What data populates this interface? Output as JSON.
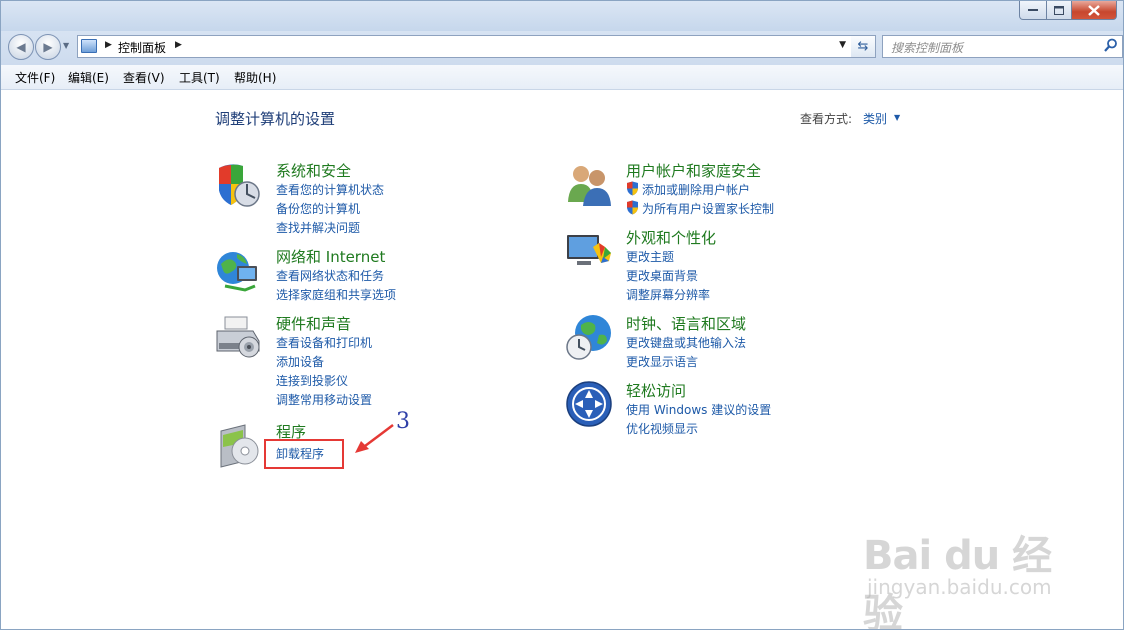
{
  "window": {
    "address": {
      "path": "控制面板"
    },
    "search": {
      "placeholder": "搜索控制面板"
    }
  },
  "menubar": [
    "文件(F)",
    "编辑(E)",
    "查看(V)",
    "工具(T)",
    "帮助(H)"
  ],
  "page": {
    "heading": "调整计算机的设置",
    "view_by_label": "查看方式:",
    "view_by_value": "类别"
  },
  "categories": [
    {
      "title": "系统和安全",
      "icon": "shield-icon",
      "links": [
        "查看您的计算机状态",
        "备份您的计算机",
        "查找并解决问题"
      ]
    },
    {
      "title": "网络和 Internet",
      "icon": "network-globe-icon",
      "links": [
        "查看网络状态和任务",
        "选择家庭组和共享选项"
      ]
    },
    {
      "title": "硬件和声音",
      "icon": "printer-icon",
      "links": [
        "查看设备和打印机",
        "添加设备",
        "连接到投影仪",
        "调整常用移动设置"
      ]
    },
    {
      "title": "程序",
      "icon": "programs-disc-icon",
      "links": [
        "卸载程序"
      ]
    },
    {
      "title": "用户帐户和家庭安全",
      "icon": "users-icon",
      "links": [
        "添加或删除用户帐户",
        "为所有用户设置家长控制"
      ]
    },
    {
      "title": "外观和个性化",
      "icon": "monitor-palette-icon",
      "links": [
        "更改主题",
        "更改桌面背景",
        "调整屏幕分辨率"
      ]
    },
    {
      "title": "时钟、语言和区域",
      "icon": "clock-globe-icon",
      "links": [
        "更改键盘或其他输入法",
        "更改显示语言"
      ]
    },
    {
      "title": "轻松访问",
      "icon": "ease-of-access-icon",
      "links": [
        "使用 Windows 建议的设置",
        "优化视频显示"
      ]
    }
  ],
  "annotation": {
    "number": "3"
  },
  "watermark": {
    "brand": "Bai du 经验",
    "url": "jingyan.baidu.com"
  }
}
